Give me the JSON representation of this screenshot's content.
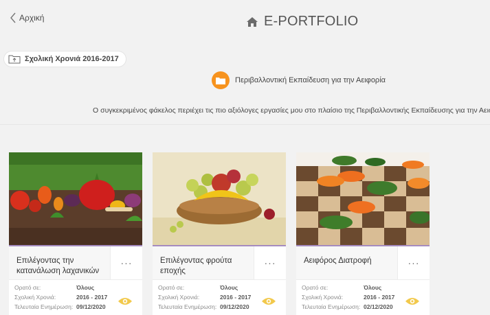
{
  "nav": {
    "back_label": "Αρχική"
  },
  "header": {
    "title": "E-PORTFOLIO"
  },
  "school_year": {
    "label": "Σχολική Χρονιά 2016-2017"
  },
  "folder": {
    "name": "Περιβαλλοντική Εκπαίδευση για την Αειφορία",
    "description": "Ο συγκεκριμένος φάκελος περιέχει τις πιο αξιόλογες εργασίες μου στο πλαίσιο της Περιβαλλοντικής Εκπαίδευσης για την Αειφορία!",
    "accent_color": "#f7931e"
  },
  "labels": {
    "visible_to": "Ορατό σε:",
    "school_year": "Σχολική Χρονιά:",
    "last_update": "Τελευταία Ενημέρωση:",
    "more": "···"
  },
  "cards": [
    {
      "title": "Επιλέγοντας την κατανάλωση λαχανικών",
      "visible_to": "Όλους",
      "school_year": "2016 - 2017",
      "last_update": "09/12/2020",
      "image": "vegetables-on-grass"
    },
    {
      "title": "Επιλέγοντας φρούτα εποχής",
      "visible_to": "Όλους",
      "school_year": "2016 - 2017",
      "last_update": "09/12/2020",
      "image": "fruit-basket"
    },
    {
      "title": "Αειφόρος Διατροφή",
      "visible_to": "Όλους",
      "school_year": "2016 - 2017",
      "last_update": "02/12/2020",
      "image": "vegetable-checkerboard"
    }
  ],
  "colors": {
    "background": "#f2f2f2",
    "card_image_border": "#a58bc0",
    "eye_icon": "#f2c94c"
  }
}
